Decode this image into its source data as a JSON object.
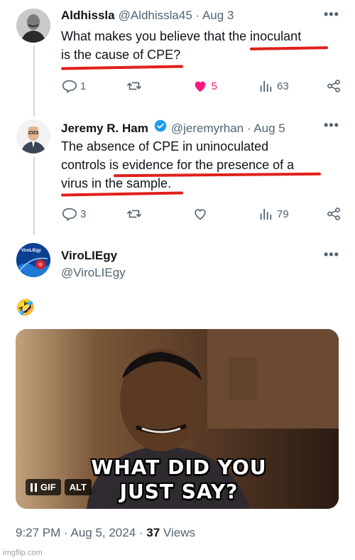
{
  "tweets": [
    {
      "name": "Aldhissla",
      "handle": "@Aldhissla45 · Aug 3",
      "lines": [
        "What makes you believe that the inoculant",
        "is the cause of CPE?"
      ],
      "replies": "1",
      "likes": "5",
      "views": "63"
    },
    {
      "name": "Jeremy R. Ham",
      "handle": "@jeremyrhan · Aug 5",
      "lines": [
        "The absence of CPE in uninoculated",
        "controls is evidence for the presence of a",
        "virus in the sample."
      ],
      "replies": "3",
      "views": "79"
    }
  ],
  "main_tweet": {
    "name": "ViroLIEgy",
    "handle": "@ViroLIEgy",
    "avatar_text": "ViroLIEgy",
    "emoji": "🤣",
    "gif_caption": [
      "WHAT DID YOU",
      "JUST SAY?"
    ],
    "gif_badges": {
      "gif": "GIF",
      "alt": "ALT"
    },
    "time": "9:27 PM · Aug 5, 2024 · ",
    "view_count": "37",
    "views_label": " Views"
  },
  "icons": {
    "more": "more-dots-icon",
    "reply": "reply-icon",
    "retweet": "retweet-icon",
    "like": "heart-icon",
    "views": "analytics-icon",
    "share": "share-icon",
    "verified": "verified-badge-icon",
    "pause": "pause-icon"
  },
  "colors": {
    "like_active": "#f91880",
    "verified": "#1d9bf0",
    "annotation_red": "#e0201a",
    "muted": "#536471"
  },
  "watermark": "imgflip.com"
}
